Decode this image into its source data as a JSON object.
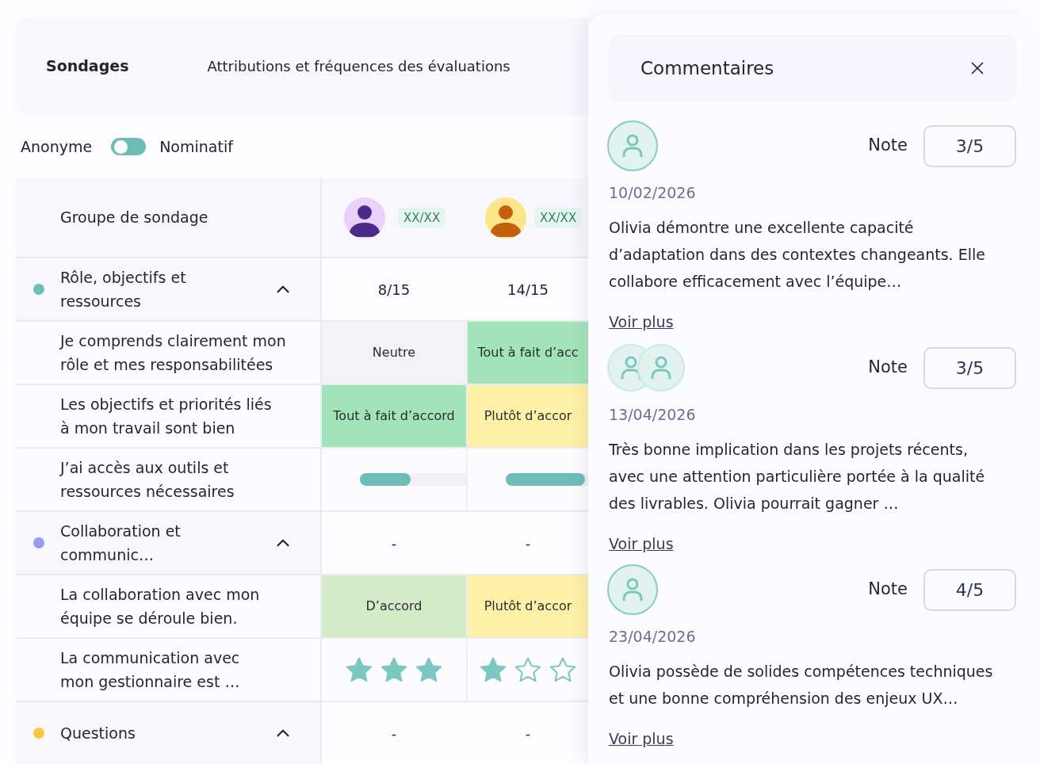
{
  "header": {
    "title": "Sondages",
    "subtitle": "Attributions et fréquences des évaluations"
  },
  "mode_toggle": {
    "left_label": "Anonyme",
    "right_label": "Nominatif",
    "on": false
  },
  "table": {
    "header_label": "Groupe de sondage",
    "columns": [
      {
        "color": "#ead1fb",
        "figure": {
          "color": "#4b2b8a"
        },
        "score": "XX/XX"
      },
      {
        "color": "#fde68a",
        "figure": {
          "color": "#c2600c"
        },
        "score": "XX/XX"
      }
    ],
    "sections": [
      {
        "name": "Rôle, objectifs et\nressources",
        "color": "#6cc0b8",
        "expanded": true,
        "values": [
          "8/15",
          "14/15"
        ],
        "questions": [
          {
            "label": "Je comprends clairement mon\nrôle et mes responsabilitées",
            "kind": "answers",
            "cells": [
              {
                "text": "Neutre",
                "color": "#f3f2f7"
              },
              {
                "text": "Tout à fait d’acc",
                "color": "#a3e3b9"
              }
            ]
          },
          {
            "label": "Les objectifs et priorités liés\nà mon travail sont bien",
            "kind": "answers",
            "cells": [
              {
                "text": "Tout à fait d’accord",
                "color": "#a3e3b9"
              },
              {
                "text": "Plutôt d’accor",
                "color": "#fef0a6"
              }
            ]
          },
          {
            "label": "J’ai accès aux outils et\nressources nécessaires",
            "kind": "progress",
            "cells": [
              {
                "level": 0.48
              },
              {
                "level": 0.96
              }
            ]
          }
        ]
      },
      {
        "name": "Collaboration et\ncommunic…",
        "color": "#959cf2",
        "expanded": true,
        "values": [
          "-",
          "-"
        ],
        "questions": [
          {
            "label": "La collaboration avec mon\néquipe se déroule bien.",
            "kind": "answers",
            "cells": [
              {
                "text": "D’accord",
                "color": "#d3ecc7"
              },
              {
                "text": "Plutôt d’accor",
                "color": "#fef0a6"
              }
            ]
          },
          {
            "label": "La communication avec\nmon gestionnaire est …",
            "kind": "stars",
            "cells": [
              {
                "stars": 3
              },
              {
                "stars": 1
              }
            ]
          }
        ]
      },
      {
        "name": "Questions",
        "color": "#f8c840",
        "expanded": true,
        "values": [
          "-",
          "-"
        ]
      }
    ]
  },
  "comments_panel": {
    "title": "Commentaires",
    "comments": [
      {
        "kind": "single",
        "note_label": "Note",
        "note": "3/5",
        "date": "10/02/2026",
        "text": "Olivia démontre une excellente capacité\nd’adaptation dans des contextes changeants. Elle\ncollabore efficacement avec l’équipe…",
        "link": "Voir plus"
      },
      {
        "kind": "group",
        "note_label": "Note",
        "note": "3/5",
        "date": "13/04/2026",
        "text": "Très bonne implication dans les projets récents,\navec une attention particulière portée à la qualité\ndes livrables. Olivia pourrait gagner …",
        "link": "Voir plus"
      },
      {
        "kind": "single",
        "note_label": "Note",
        "note": "4/5",
        "date": "23/04/2026",
        "text": "Olivia possède de solides compétences techniques\net une bonne compréhension des enjeux UX…",
        "link": "Voir plus"
      }
    ]
  }
}
